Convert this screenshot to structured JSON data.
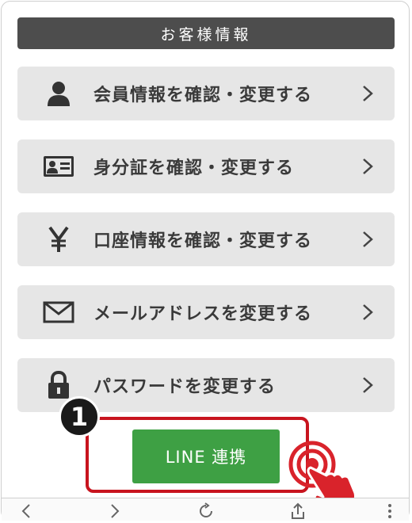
{
  "section": {
    "title": "お客様情報"
  },
  "menu": {
    "items": [
      {
        "label": "会員情報を確認・変更する",
        "icon": "person-icon"
      },
      {
        "label": "身分証を確認・変更する",
        "icon": "id-card-icon"
      },
      {
        "label": "口座情報を確認・変更する",
        "icon": "yen-icon"
      },
      {
        "label": "メールアドレスを変更する",
        "icon": "envelope-icon"
      },
      {
        "label": "パスワードを変更する",
        "icon": "lock-icon"
      }
    ]
  },
  "callout": {
    "step_number": "1"
  },
  "line_button": {
    "label": "LINE 連携"
  },
  "colors": {
    "header_bg": "#4d4d4d",
    "item_bg": "#e6e6e6",
    "line_green": "#3ea044",
    "highlight_red": "#c8141e"
  },
  "nav": {
    "icons": [
      "back-icon",
      "forward-icon",
      "reload-icon",
      "share-icon",
      "more-icon"
    ]
  }
}
